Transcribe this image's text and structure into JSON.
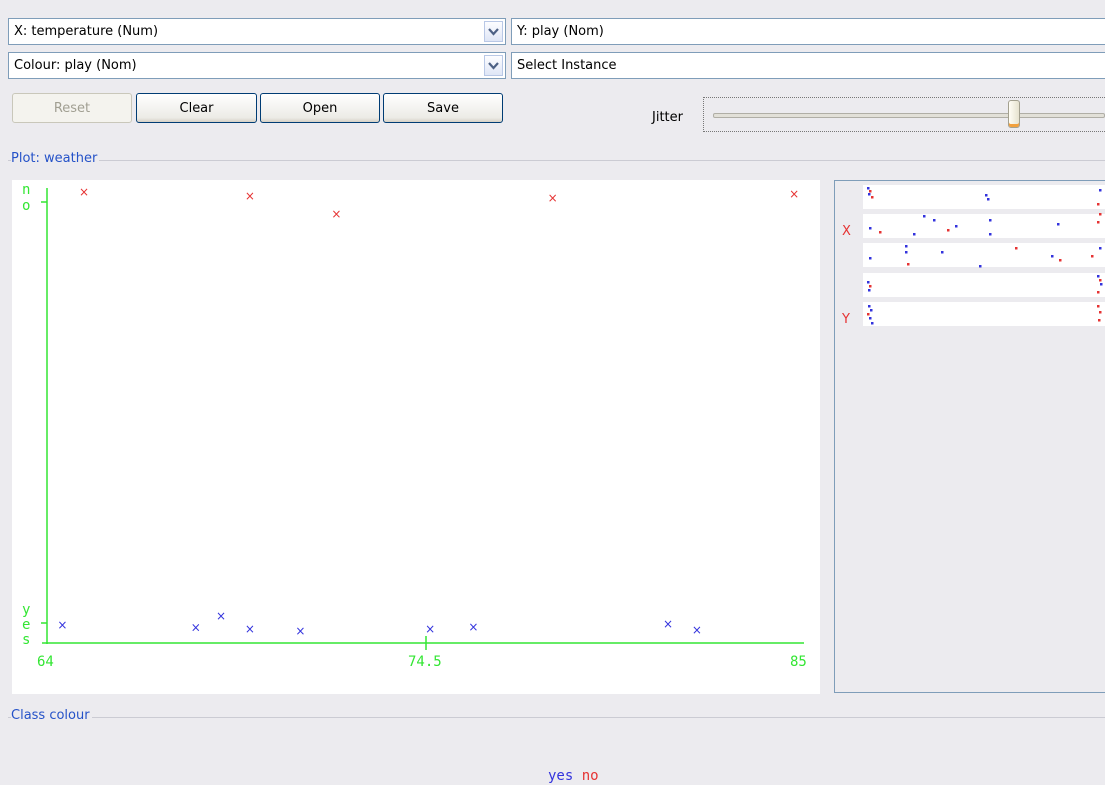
{
  "controls": {
    "x_axis_value": "X: temperature (Num)",
    "y_axis_value": "Y: play (Nom)",
    "colour_value": "Colour: play (Nom)",
    "instance_value": "Select Instance"
  },
  "buttons": {
    "reset": "Reset",
    "clear": "Clear",
    "open": "Open",
    "save": "Save"
  },
  "jitter": {
    "label": "Jitter",
    "level": 0.79
  },
  "plot": {
    "title": "Plot: weather",
    "x_ticks": [
      "64",
      "74.5",
      "85"
    ],
    "y_top": [
      "n",
      "o"
    ],
    "y_bottom": [
      "y",
      "e",
      "s"
    ]
  },
  "chart_data": {
    "type": "scatter",
    "xlabel": "temperature",
    "ylabel": "play",
    "xlim": [
      64,
      85
    ],
    "categories": [
      "yes",
      "no"
    ],
    "series": [
      {
        "name": "yes",
        "color": "#3333dd",
        "values": [
          [
            64.4,
            "yes"
          ],
          [
            68.1,
            "yes"
          ],
          [
            68.8,
            "yes"
          ],
          [
            69.6,
            "yes"
          ],
          [
            71.0,
            "yes"
          ],
          [
            74.6,
            "yes"
          ],
          [
            75.8,
            "yes"
          ],
          [
            81.2,
            "yes"
          ],
          [
            82.0,
            "yes"
          ]
        ]
      },
      {
        "name": "no",
        "color": "#e63333",
        "values": [
          [
            65.0,
            "no"
          ],
          [
            69.6,
            "no"
          ],
          [
            72.0,
            "no"
          ],
          [
            78.0,
            "no"
          ],
          [
            84.7,
            "no"
          ]
        ]
      }
    ]
  },
  "matrix": {
    "row_labels": [
      "X",
      "Y"
    ]
  },
  "legend": {
    "title": "Class colour",
    "yes": "yes",
    "no": "no",
    "yes_color": "#3333dd",
    "no_color": "#e63333"
  },
  "colors": {
    "axis": "#33e633",
    "title": "#2552c8"
  }
}
